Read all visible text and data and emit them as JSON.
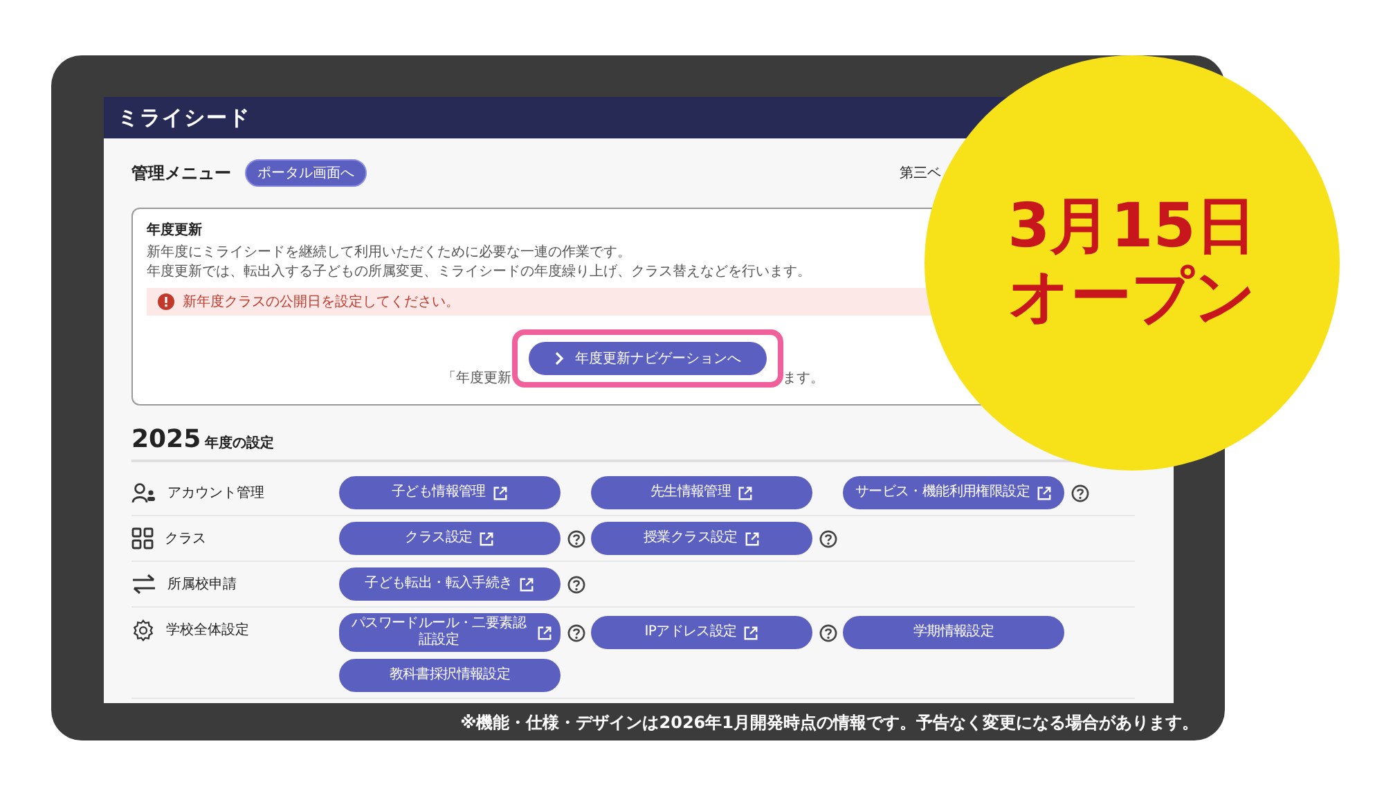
{
  "header": {
    "logo": "ミライシード",
    "right_text": "第三ベ"
  },
  "menu": {
    "title": "管理メニュー",
    "portal_button": "ポータル画面へ"
  },
  "card": {
    "title": "年度更新",
    "description": [
      "新年度にミライシードを継続して利用いただくために必要な一連の作業です。",
      "年度更新では、転出入する子どもの所属変更、ミライシードの年度繰り上げ、クラス替えなどを行います。"
    ],
    "alert": "新年度クラスの公開日を設定してください。",
    "nav_button": {
      "label": "年度更新ナビゲーションへ",
      "highlighted": true
    },
    "note_start": "「年度更新",
    "note_end": "ます。"
  },
  "section": {
    "year": "2025",
    "title": "年度の設定"
  },
  "rows": [
    {
      "kind": "account",
      "label": "アカウント管理",
      "buttons": [
        {
          "label": "子ども情報管理",
          "external": true,
          "help": false
        },
        {
          "label": "先生情報管理",
          "external": true,
          "help": false
        },
        {
          "label": "サービス・機能利用権限設定",
          "external": true,
          "help": true
        }
      ]
    },
    {
      "kind": "grid",
      "label": "クラス",
      "buttons": [
        {
          "label": "クラス設定",
          "external": true,
          "help": true
        },
        {
          "label": "授業クラス設定",
          "external": true,
          "help": true
        }
      ]
    },
    {
      "kind": "swap",
      "label": "所属校申請",
      "buttons": [
        {
          "label": "子ども転出・転入手続き",
          "external": true,
          "help": true
        }
      ]
    },
    {
      "kind": "gear",
      "label": "学校全体設定",
      "buttons": [
        {
          "label": "パスワードルール・二要素認証設定",
          "external": true,
          "help": true
        },
        {
          "label": "IPアドレス設定",
          "external": true,
          "help": true
        },
        {
          "label": "学期情報設定",
          "external": false,
          "help": false
        },
        {
          "label": "教科書採択情報設定",
          "external": false,
          "help": false
        }
      ]
    }
  ],
  "badge": {
    "line1": "3月15日",
    "line2": "オープン"
  },
  "footer": "※機能・仕様・デザインは2026年1月開発時点の情報です。予告なく変更になる場合があります。"
}
